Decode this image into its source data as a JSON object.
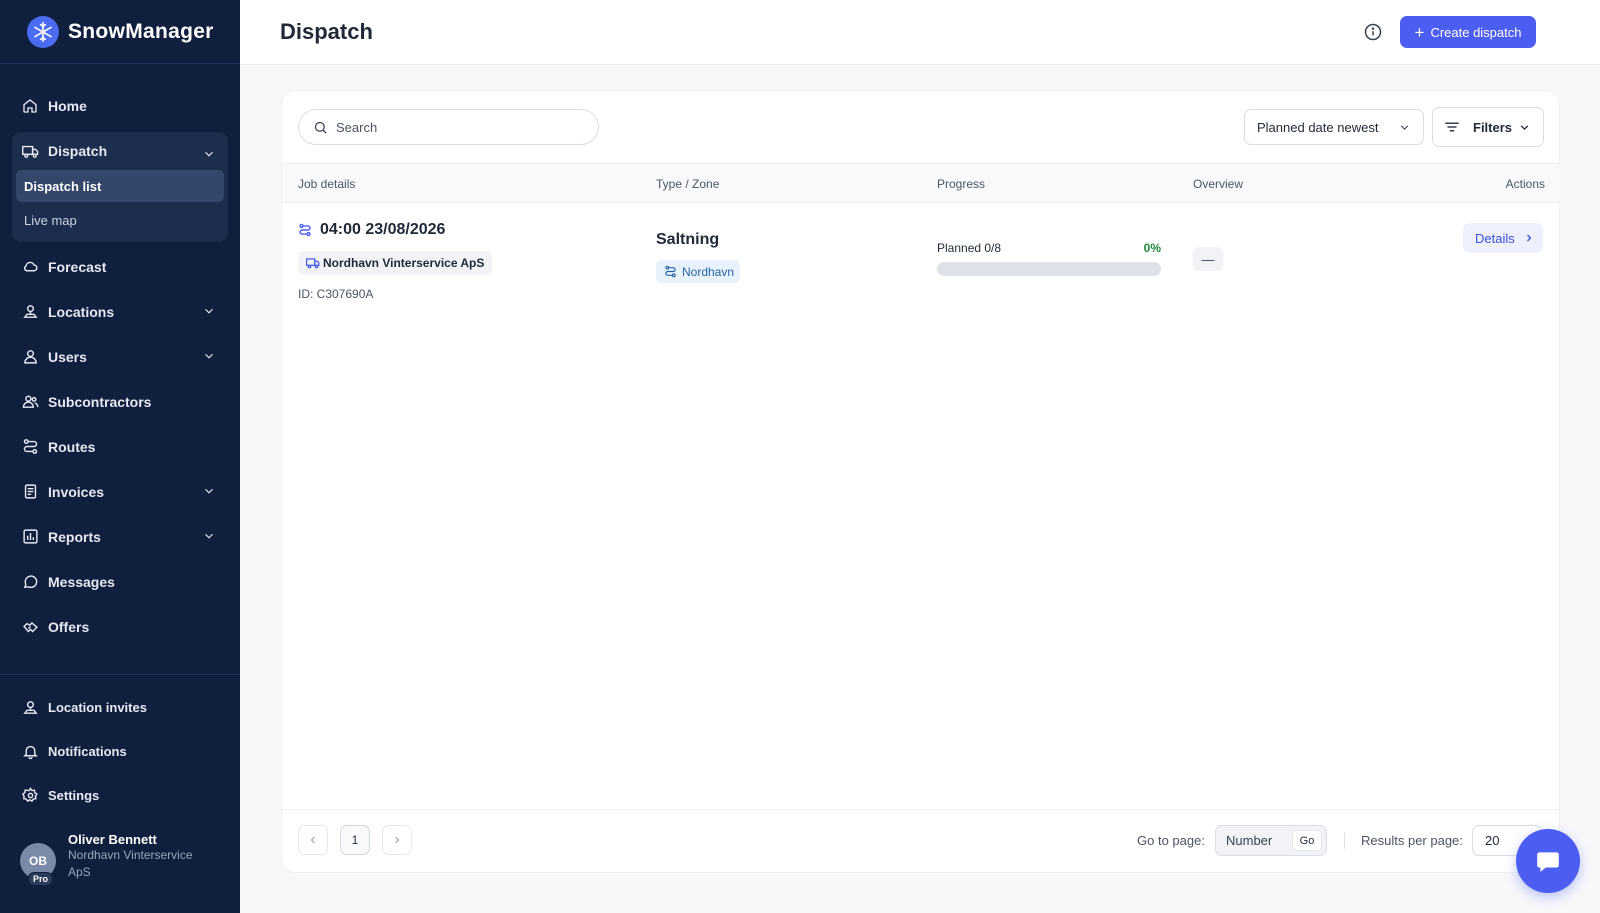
{
  "app": {
    "name": "SnowManager"
  },
  "sidebar": {
    "items": [
      {
        "id": "home",
        "label": "Home",
        "icon": "home-icon"
      },
      {
        "id": "dispatch",
        "label": "Dispatch",
        "icon": "truck-icon",
        "expanded": true,
        "children": [
          {
            "label": "Dispatch list",
            "active": true
          },
          {
            "label": "Live map"
          }
        ]
      },
      {
        "id": "forecast",
        "label": "Forecast",
        "icon": "cloud-icon"
      },
      {
        "id": "locations",
        "label": "Locations",
        "icon": "location-pin-icon"
      },
      {
        "id": "users",
        "label": "Users",
        "icon": "user-icon"
      },
      {
        "id": "subcontractors",
        "label": "Subcontractors",
        "icon": "users-icon"
      },
      {
        "id": "routes",
        "label": "Routes",
        "icon": "route-icon"
      },
      {
        "id": "invoices",
        "label": "Invoices",
        "icon": "document-icon"
      },
      {
        "id": "reports",
        "label": "Reports",
        "icon": "bar-chart-icon"
      },
      {
        "id": "messages",
        "label": "Messages",
        "icon": "chat-icon"
      },
      {
        "id": "offers",
        "label": "Offers",
        "icon": "handshake-icon"
      }
    ],
    "bottom_items": [
      {
        "id": "location-invites",
        "label": "Location invites",
        "icon": "location-pin-icon"
      },
      {
        "id": "notifications",
        "label": "Notifications",
        "icon": "bell-icon"
      },
      {
        "id": "settings",
        "label": "Settings",
        "icon": "gear-icon"
      }
    ],
    "user": {
      "initials": "OB",
      "badge": "Pro",
      "name": "Oliver Bennett",
      "org": "Nordhavn Vinterservice ApS"
    }
  },
  "header": {
    "title": "Dispatch",
    "create_label": "Create dispatch"
  },
  "toolbar": {
    "search_placeholder": "Search",
    "sort_label": "Planned date newest",
    "filters_label": "Filters"
  },
  "table": {
    "columns": [
      "Job details",
      "Type / Zone",
      "Progress",
      "Overview",
      "Actions"
    ],
    "rows": [
      {
        "time": "04:00 23/08/2026",
        "company": "Nordhavn Vinterservice ApS",
        "id": "ID: C307690A",
        "type": "Saltning",
        "zone": "Nordhavn",
        "progress_label": "Planned 0/8",
        "progress_pct_text": "0%",
        "progress_fraction": 0,
        "overview": "—",
        "action_label": "Details"
      }
    ]
  },
  "pagination": {
    "current_page": "1",
    "goto_label": "Go to page:",
    "goto_placeholder": "Number",
    "go_label": "Go",
    "rpp_label": "Results per page:",
    "rpp_value": "20"
  },
  "colors": {
    "sidebar_bg": "#0f1f3d",
    "accent": "#4b5ef1",
    "success": "#1f8a3a"
  }
}
